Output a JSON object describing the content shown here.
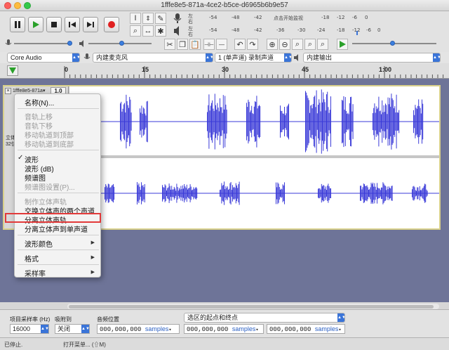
{
  "window": {
    "title": "1fffe8e5-871a-4ce2-b5ce-d6965b6b9e57"
  },
  "meters": {
    "rec_ticks": [
      "-54",
      "-48",
      "-42",
      "点击开始监视",
      "-18",
      "-12",
      "-6",
      "0"
    ],
    "play_ticks": [
      "-54",
      "-48",
      "-42",
      "-36",
      "-30",
      "-24",
      "-18",
      "-12",
      "-6",
      "0"
    ],
    "left": "左",
    "right": "右"
  },
  "devices": {
    "host": "Core Audio",
    "recording_device": "内建麦克风",
    "channels": "1 (单声道) 录制声道",
    "playback_device": "内建输出"
  },
  "ruler": {
    "ticks": [
      "0",
      "15",
      "30",
      "45",
      "1:00"
    ]
  },
  "track": {
    "name": "1fffe8e5-871a",
    "name_suffix": "▾",
    "gain_value": "1.0",
    "info_line1": "立体",
    "info_line2": "32位"
  },
  "menu": {
    "items": [
      {
        "label": "名称(N)...",
        "enabled": true,
        "checked": false,
        "submenu": false
      },
      {
        "label": "音轨上移",
        "enabled": false,
        "checked": false,
        "submenu": false
      },
      {
        "label": "音轨下移",
        "enabled": false,
        "checked": false,
        "submenu": false
      },
      {
        "label": "移动轨道到顶部",
        "enabled": false,
        "checked": false,
        "submenu": false
      },
      {
        "label": "移动轨道到底部",
        "enabled": false,
        "checked": false,
        "submenu": false
      },
      {
        "label": "波形",
        "enabled": true,
        "checked": true,
        "submenu": false
      },
      {
        "label": "波形 (dB)",
        "enabled": true,
        "checked": false,
        "submenu": false
      },
      {
        "label": "频谱图",
        "enabled": true,
        "checked": false,
        "submenu": false
      },
      {
        "label": "频谱图设置(P)...",
        "enabled": false,
        "checked": false,
        "submenu": false
      },
      {
        "label": "制作立体声轨",
        "enabled": false,
        "checked": false,
        "submenu": false
      },
      {
        "label": "交换立体声的两个声道",
        "enabled": true,
        "checked": false,
        "submenu": false
      },
      {
        "label": "分离立体声轨",
        "enabled": true,
        "checked": false,
        "submenu": false,
        "highlighted": true
      },
      {
        "label": "分离立体声到单声道",
        "enabled": true,
        "checked": false,
        "submenu": false
      },
      {
        "label": "波形颜色",
        "enabled": true,
        "checked": false,
        "submenu": true
      },
      {
        "label": "格式",
        "enabled": true,
        "checked": false,
        "submenu": true
      },
      {
        "label": "采样率",
        "enabled": true,
        "checked": false,
        "submenu": true
      }
    ],
    "check_mark": "✓",
    "submenu_arrow": "▶"
  },
  "selection": {
    "rate_label": "项目采样率 (Hz)",
    "rate_value": "16000",
    "snap_label": "吸附到",
    "snap_value": "关闭",
    "pos_label": "音频位置",
    "pos_value": "000,000,000",
    "unit": "samples",
    "range_mode": "选区的起点和终点",
    "start_value": "000,000,000",
    "end_value": "000,000,000"
  },
  "status": {
    "left": "已停止.",
    "right": "打开菜单... (⇧M)"
  },
  "colors": {
    "wave": "#3b3bd8",
    "accent": "#3a74d8",
    "highlight_box": "#e23a3a"
  }
}
